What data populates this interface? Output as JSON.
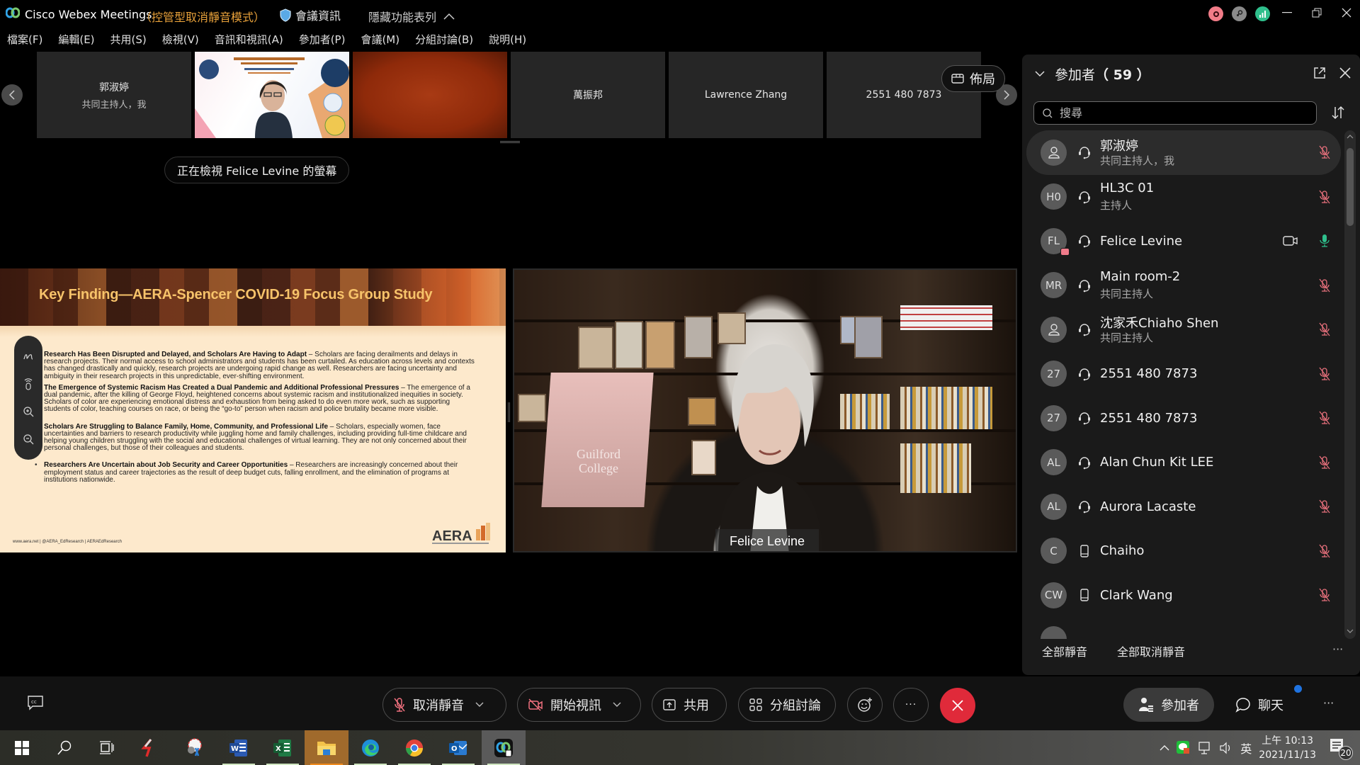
{
  "window": {
    "app_name": "Cisco Webex Meetings",
    "mode": "（控管型取消靜音模式）",
    "meeting_info": "會議資訊",
    "hide_menu": "隱藏功能表列",
    "status_icons": [
      "recording-icon",
      "link-icon",
      "network-stats-icon"
    ],
    "colors": {
      "mode_text": "#e8a13a",
      "recording": "#f27c88",
      "network": "#2fbf8c"
    }
  },
  "menu": {
    "items": [
      "檔案(F)",
      "編輯(E)",
      "共用(S)",
      "檢視(V)",
      "音訊和視訊(A)",
      "參加者(P)",
      "會議(M)",
      "分組討論(B)",
      "說明(H)"
    ]
  },
  "filmstrip": {
    "tiles": [
      {
        "name": "郭淑婷",
        "sub": "共同主持人，我",
        "type": "name"
      },
      {
        "name": "",
        "sub": "",
        "type": "video"
      },
      {
        "name": "",
        "sub": "",
        "type": "video"
      },
      {
        "name": "萬振邦",
        "sub": "",
        "type": "name"
      },
      {
        "name": "Lawrence Zhang",
        "sub": "",
        "type": "name"
      },
      {
        "name": "2551 480 7873",
        "sub": "",
        "type": "name"
      }
    ],
    "layout_label": "佈局"
  },
  "stage": {
    "viewing_label": "正在檢視 Felice Levine 的螢幕",
    "speaker_name": "Felice Levine",
    "chair_text_1": "Guilford",
    "chair_text_2": "College"
  },
  "slide": {
    "title": "Key Finding—AERA-Spencer COVID-19 Focus Group Study",
    "bullets": [
      {
        "heading": "Research Has Been Disrupted and Delayed, and Scholars Are Having to Adapt",
        "text": " – Scholars are facing derailments and delays in research projects. Their normal access to school administrators and students has been curtailed. As education across levels and contexts has changed drastically and quickly, research projects are undergoing rapid change as well. Researchers are facing uncertainty and ambiguity in their research projects in this unpredictable, ever-shifting environment."
      },
      {
        "heading": "The Emergence of Systemic Racism Has Created a Dual Pandemic and Additional Professional Pressures",
        "text": " – The emergence of a dual pandemic, after the killing of George Floyd, heightened concerns about systemic racism and institutionalized inequities in society. Scholars of color are experiencing emotional distress and exhaustion from being asked to do even more work, such as supporting students of color, teaching courses on race, or being the “go-to” person when racism and police brutality became more visible."
      },
      {
        "heading": "Scholars Are Struggling to Balance Family, Home, Community, and Professional Life",
        "text": " – Scholars, especially women, face uncertainties and barriers to research productivity while juggling home and family challenges, including providing full-time childcare and helping young children struggling with the social and educational challenges of virtual learning. They are not only concerned about their personal challenges, but those of their colleagues and students."
      },
      {
        "heading": "Researchers Are Uncertain about Job Security and Career Opportunities",
        "text": " – Researchers are increasingly concerned about their employment status and career trajectories as the result of deep budget cuts, falling enrollment, and the elimination of programs at institutions nationwide."
      }
    ],
    "footer": "www.aera.net  |  @AERA_EdResearch  |  AERAEdResearch",
    "logo_text": "AERA"
  },
  "participants": {
    "title": "參加者",
    "count": "（ 59 ）",
    "search_placeholder": "搜尋",
    "list": [
      {
        "initials": "",
        "avatar": "person",
        "name": "郭淑婷",
        "role": "共同主持人，我",
        "conn": "headset",
        "mic": "muted",
        "video": false,
        "sharing": false,
        "active": true
      },
      {
        "initials": "H0",
        "avatar": "text",
        "name": "HL3C 01",
        "role": "主持人",
        "conn": "headset",
        "mic": "muted",
        "video": false,
        "sharing": false,
        "active": false
      },
      {
        "initials": "FL",
        "avatar": "text",
        "name": "Felice Levine",
        "role": "",
        "conn": "headset",
        "mic": "on",
        "video": true,
        "sharing": true,
        "active": false
      },
      {
        "initials": "MR",
        "avatar": "text",
        "name": "Main room-2",
        "role": "共同主持人",
        "conn": "headset",
        "mic": "muted",
        "video": false,
        "sharing": false,
        "active": false
      },
      {
        "initials": "",
        "avatar": "person",
        "name": "沈家禾Chiaho Shen",
        "role": "共同主持人",
        "conn": "headset",
        "mic": "muted",
        "video": false,
        "sharing": false,
        "active": false
      },
      {
        "initials": "27",
        "avatar": "text",
        "name": "2551 480 7873",
        "role": "",
        "conn": "headset",
        "mic": "muted",
        "video": false,
        "sharing": false,
        "active": false
      },
      {
        "initials": "27",
        "avatar": "text",
        "name": "2551 480 7873",
        "role": "",
        "conn": "headset",
        "mic": "muted",
        "video": false,
        "sharing": false,
        "active": false
      },
      {
        "initials": "AL",
        "avatar": "text",
        "name": "Alan Chun Kit LEE",
        "role": "",
        "conn": "headset",
        "mic": "muted",
        "video": false,
        "sharing": false,
        "active": false
      },
      {
        "initials": "AL",
        "avatar": "text",
        "name": "Aurora Lacaste",
        "role": "",
        "conn": "headset",
        "mic": "muted",
        "video": false,
        "sharing": false,
        "active": false
      },
      {
        "initials": "C",
        "avatar": "text",
        "name": "Chaiho",
        "role": "",
        "conn": "mobile",
        "mic": "muted",
        "video": false,
        "sharing": false,
        "active": false
      },
      {
        "initials": "CW",
        "avatar": "text",
        "name": "Clark Wang",
        "role": "",
        "conn": "mobile",
        "mic": "muted",
        "video": false,
        "sharing": false,
        "active": false
      }
    ],
    "mute_all": "全部靜音",
    "unmute_all": "全部取消靜音",
    "colors": {
      "muted": "#e8707c",
      "unmuted": "#2fbf8c"
    }
  },
  "controls": {
    "unmute": "取消靜音",
    "start_video": "開始視訊",
    "share": "共用",
    "breakout": "分組討論",
    "participants": "參加者",
    "chat": "聊天",
    "colors": {
      "leave": "#e02a3a",
      "chat_badge": "#1f73e0"
    }
  },
  "taskbar": {
    "apps": [
      "start-icon",
      "search-icon",
      "task-view-icon",
      "app-icon",
      "snipping-tool-icon",
      "word-icon",
      "excel-icon",
      "file-explorer-icon",
      "edge-icon",
      "chrome-icon",
      "outlook-icon",
      "webex-icon"
    ],
    "ime": "英",
    "time": "上午 10:13",
    "date": "2021/11/13",
    "notifications": "20"
  }
}
